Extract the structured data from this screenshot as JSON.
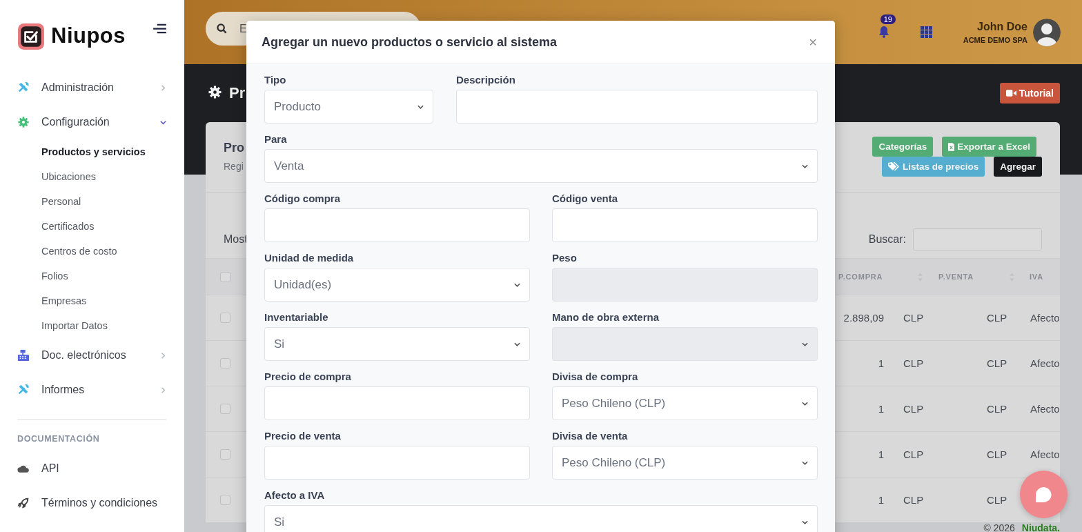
{
  "sidebar": {
    "brand": "Niupos",
    "menu": [
      {
        "label": "Administración",
        "expanded": false
      },
      {
        "label": "Configuración",
        "expanded": true,
        "children": [
          {
            "label": "Productos y servicios",
            "selected": true
          },
          {
            "label": "Ubicaciones",
            "selected": false
          },
          {
            "label": "Personal",
            "selected": false
          },
          {
            "label": "Certificados",
            "selected": false
          },
          {
            "label": "Centros de costo",
            "selected": false
          },
          {
            "label": "Folios",
            "selected": false
          },
          {
            "label": "Empresas",
            "selected": false
          },
          {
            "label": "Importar Datos",
            "selected": false
          }
        ]
      },
      {
        "label": "Doc. electrónicos",
        "expanded": false
      },
      {
        "label": "Informes",
        "expanded": false
      }
    ],
    "section_title": "DOCUMENTACIÓN",
    "docs": [
      {
        "label": "API"
      },
      {
        "label": "Términos y condiciones"
      }
    ]
  },
  "topbar": {
    "search": {
      "placeholder": "E"
    },
    "notifications": "19",
    "user": {
      "name": "John Doe",
      "company": "ACME DEMO SPA"
    }
  },
  "page": {
    "title": "Pr",
    "tutorial_button": "Tutorial"
  },
  "card": {
    "title": "Pro",
    "subtitle": "Regi",
    "buttons": [
      {
        "label": "Categorías",
        "kind": "categories"
      },
      {
        "label": "Exportar a Excel",
        "kind": "export"
      },
      {
        "label": "Listas de precios",
        "kind": "price-lists"
      },
      {
        "label": "Agregar",
        "kind": "add"
      }
    ],
    "length_label": "Most",
    "search_label": "Buscar:"
  },
  "table": {
    "select_all_checked": false,
    "columns": [
      {
        "label": "P.COMPRA"
      },
      {
        "label": "P.VENTA"
      },
      {
        "label": "IVA"
      }
    ],
    "rows": [
      {
        "checked": false,
        "p_compra": "2.898,09",
        "compra_currency": "CLP",
        "venta_currency": "CLP",
        "iva": "Afecto"
      },
      {
        "checked": false,
        "p_compra": "1",
        "compra_currency": "CLP",
        "venta_currency": "CLP",
        "iva": "Afecto"
      },
      {
        "checked": false,
        "p_compra": "1",
        "compra_currency": "CLP",
        "venta_currency": "CLP",
        "iva": "Afecto"
      },
      {
        "checked": false,
        "p_compra": "1",
        "compra_currency": "CLP",
        "venta_currency": "CLP",
        "iva": "Afecto"
      },
      {
        "checked": false,
        "p_compra": "1",
        "compra_currency": "CLP",
        "venta_currency": "CLP"
      }
    ]
  },
  "modal": {
    "title": "Agregar un nuevo productos o servicio al sistema",
    "close": "×",
    "rows": [
      {
        "fields": [
          {
            "label": "Tipo",
            "kind": "select",
            "value": "Producto",
            "disabled": false
          },
          {
            "label": "Descripción",
            "kind": "input",
            "disabled": false
          }
        ]
      },
      {
        "fields": [
          {
            "label": "Para",
            "kind": "select",
            "value": "Venta",
            "disabled": false
          }
        ]
      },
      {
        "fields": [
          {
            "label": "Código compra",
            "kind": "input",
            "disabled": false
          },
          {
            "label": "Código venta",
            "kind": "input",
            "disabled": false
          }
        ]
      },
      {
        "fields": [
          {
            "label": "Unidad de medida",
            "kind": "select",
            "value": "Unidad(es)",
            "disabled": false
          },
          {
            "label": "Peso",
            "kind": "input",
            "disabled": true
          }
        ]
      },
      {
        "fields": [
          {
            "label": "Inventariable",
            "kind": "select",
            "value": "Si",
            "disabled": false
          },
          {
            "label": "Mano de obra externa",
            "kind": "select",
            "disabled": true
          }
        ]
      },
      {
        "fields": [
          {
            "label": "Precio de compra",
            "kind": "input",
            "disabled": false
          },
          {
            "label": "Divisa de compra",
            "kind": "select",
            "value": "Peso Chileno (CLP)",
            "disabled": false
          }
        ]
      },
      {
        "fields": [
          {
            "label": "Precio de venta",
            "kind": "input",
            "disabled": false
          },
          {
            "label": "Divisa de venta",
            "kind": "select",
            "value": "Peso Chileno (CLP)",
            "disabled": false
          }
        ]
      },
      {
        "fields": [
          {
            "label": "Afecto a IVA",
            "kind": "select",
            "value": "Si",
            "disabled": false
          }
        ]
      }
    ]
  },
  "footer": {
    "copyright": "© 2026",
    "link": "Niudata."
  }
}
